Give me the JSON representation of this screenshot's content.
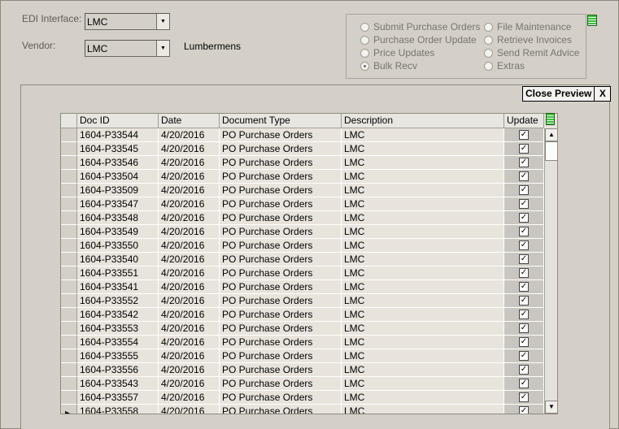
{
  "form": {
    "edi_label": "EDI Interface:",
    "edi_value": "LMC",
    "vendor_label": "Vendor:",
    "vendor_value": "LMC",
    "vendor_name": "Lumbermens"
  },
  "options": {
    "left": [
      {
        "label": "Submit Purchase Orders",
        "selected": false
      },
      {
        "label": "Purchase Order Update",
        "selected": false
      },
      {
        "label": "Price Updates",
        "selected": false
      },
      {
        "label": "Bulk Recv",
        "selected": true
      }
    ],
    "right": [
      {
        "label": "File Maintenance",
        "selected": false
      },
      {
        "label": "Retrieve Invoices",
        "selected": false
      },
      {
        "label": "Send Remit Advice",
        "selected": false
      },
      {
        "label": "Extras",
        "selected": false
      }
    ]
  },
  "preview": {
    "close_label": "Close Preview",
    "x_label": "X"
  },
  "grid": {
    "columns": [
      "Doc ID",
      "Date",
      "Document Type",
      "Description",
      "Update"
    ],
    "rows": [
      {
        "doc_id": "1604-P33544",
        "date": "4/20/2016",
        "type": "PO Purchase Orders",
        "desc": "LMC",
        "update": true
      },
      {
        "doc_id": "1604-P33545",
        "date": "4/20/2016",
        "type": "PO Purchase Orders",
        "desc": "LMC",
        "update": true
      },
      {
        "doc_id": "1604-P33546",
        "date": "4/20/2016",
        "type": "PO Purchase Orders",
        "desc": "LMC",
        "update": true
      },
      {
        "doc_id": "1604-P33504",
        "date": "4/20/2016",
        "type": "PO Purchase Orders",
        "desc": "LMC",
        "update": true
      },
      {
        "doc_id": "1604-P33509",
        "date": "4/20/2016",
        "type": "PO Purchase Orders",
        "desc": "LMC",
        "update": true
      },
      {
        "doc_id": "1604-P33547",
        "date": "4/20/2016",
        "type": "PO Purchase Orders",
        "desc": "LMC",
        "update": true
      },
      {
        "doc_id": "1604-P33548",
        "date": "4/20/2016",
        "type": "PO Purchase Orders",
        "desc": "LMC",
        "update": true
      },
      {
        "doc_id": "1604-P33549",
        "date": "4/20/2016",
        "type": "PO Purchase Orders",
        "desc": "LMC",
        "update": true
      },
      {
        "doc_id": "1604-P33550",
        "date": "4/20/2016",
        "type": "PO Purchase Orders",
        "desc": "LMC",
        "update": true
      },
      {
        "doc_id": "1604-P33540",
        "date": "4/20/2016",
        "type": "PO Purchase Orders",
        "desc": "LMC",
        "update": true
      },
      {
        "doc_id": "1604-P33551",
        "date": "4/20/2016",
        "type": "PO Purchase Orders",
        "desc": "LMC",
        "update": true
      },
      {
        "doc_id": "1604-P33541",
        "date": "4/20/2016",
        "type": "PO Purchase Orders",
        "desc": "LMC",
        "update": true
      },
      {
        "doc_id": "1604-P33552",
        "date": "4/20/2016",
        "type": "PO Purchase Orders",
        "desc": "LMC",
        "update": true
      },
      {
        "doc_id": "1604-P33542",
        "date": "4/20/2016",
        "type": "PO Purchase Orders",
        "desc": "LMC",
        "update": true
      },
      {
        "doc_id": "1604-P33553",
        "date": "4/20/2016",
        "type": "PO Purchase Orders",
        "desc": "LMC",
        "update": true
      },
      {
        "doc_id": "1604-P33554",
        "date": "4/20/2016",
        "type": "PO Purchase Orders",
        "desc": "LMC",
        "update": true
      },
      {
        "doc_id": "1604-P33555",
        "date": "4/20/2016",
        "type": "PO Purchase Orders",
        "desc": "LMC",
        "update": true
      },
      {
        "doc_id": "1604-P33556",
        "date": "4/20/2016",
        "type": "PO Purchase Orders",
        "desc": "LMC",
        "update": true
      },
      {
        "doc_id": "1604-P33543",
        "date": "4/20/2016",
        "type": "PO Purchase Orders",
        "desc": "LMC",
        "update": true
      },
      {
        "doc_id": "1604-P33557",
        "date": "4/20/2016",
        "type": "PO Purchase Orders",
        "desc": "LMC",
        "update": true
      },
      {
        "doc_id": "1604-P33558",
        "date": "4/20/2016",
        "type": "PO Purchase Orders",
        "desc": "LMC",
        "update": true
      }
    ]
  },
  "icons": {
    "menu": "list-menu-icon",
    "check": "checkmark-icon",
    "current_row": "row-pointer-icon"
  }
}
